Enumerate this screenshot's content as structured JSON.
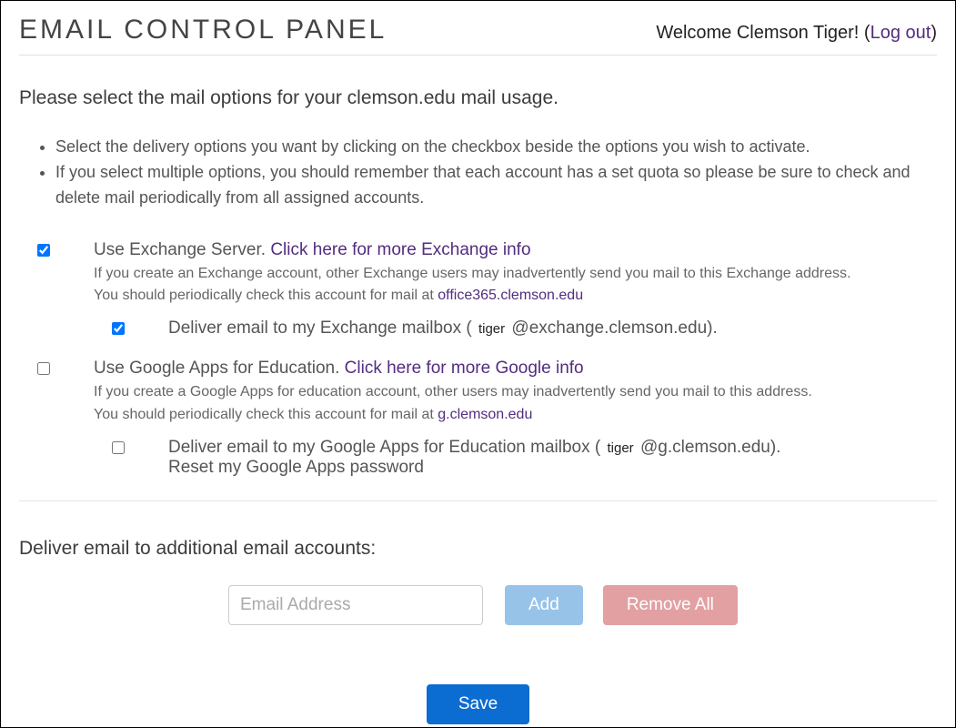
{
  "header": {
    "title": "EMAIL CONTROL PANEL",
    "welcome_prefix": "Welcome ",
    "user_name": "Clemson Tiger",
    "excl": "! ",
    "paren_open": "(",
    "logout_label": "Log out",
    "paren_close": ")"
  },
  "intro": "Please select the mail options for your clemson.edu mail usage.",
  "instructions": {
    "item1": "Select the delivery options you want by clicking on the checkbox beside the options you wish to activate.",
    "item2": "If you select multiple options, you should remember that each account has a set quota so please be sure to check and delete mail periodically from all assigned accounts."
  },
  "exchange": {
    "checked": true,
    "label_prefix": "Use Exchange Server. ",
    "link": "Click here for more Exchange info",
    "desc_line1": "If you create an Exchange account, other Exchange users may inadvertently send you mail to this Exchange address.",
    "desc_line2_prefix": "You should periodically check this account for mail at ",
    "desc_link": "office365.clemson.edu",
    "deliver": {
      "checked": true,
      "label_prefix": "Deliver email to my Exchange mailbox ( ",
      "username": "tiger",
      "label_suffix": " @exchange.clemson.edu)."
    }
  },
  "google": {
    "checked": false,
    "label_prefix": "Use Google Apps for Education. ",
    "link": "Click here for more Google info",
    "desc_line1": "If you create a Google Apps for education account, other users may inadvertently send you mail to this address.",
    "desc_line2_prefix": "You should periodically check this account for mail at ",
    "desc_link": "g.clemson.edu",
    "deliver": {
      "checked": false,
      "label_prefix": "Deliver email to my Google Apps for Education mailbox ( ",
      "username": "tiger",
      "label_suffix": " @g.clemson.edu).",
      "reset_link": "Reset my Google Apps password"
    }
  },
  "additional": {
    "heading": "Deliver email to additional email accounts:",
    "placeholder": "Email Address",
    "add_label": "Add",
    "remove_label": "Remove All"
  },
  "save_label": "Save"
}
